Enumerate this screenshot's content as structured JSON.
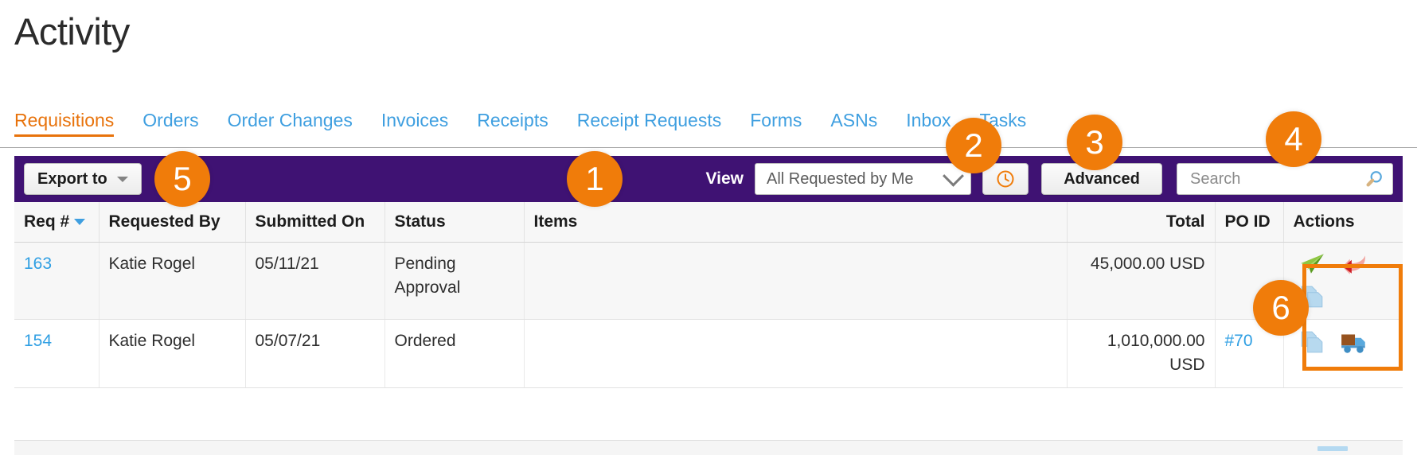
{
  "page": {
    "title": "Activity"
  },
  "tabs": [
    {
      "label": "Requisitions",
      "active": true
    },
    {
      "label": "Orders",
      "active": false
    },
    {
      "label": "Order Changes",
      "active": false
    },
    {
      "label": "Invoices",
      "active": false
    },
    {
      "label": "Receipts",
      "active": false
    },
    {
      "label": "Receipt Requests",
      "active": false
    },
    {
      "label": "Forms",
      "active": false
    },
    {
      "label": "ASNs",
      "active": false
    },
    {
      "label": "Inbox",
      "active": false
    },
    {
      "label": "Tasks",
      "active": false
    }
  ],
  "toolbar": {
    "export_label": "Export to",
    "view_label": "View",
    "view_value": "All Requested by Me",
    "history_icon": "clock-icon",
    "advanced_label": "Advanced",
    "search_placeholder": "Search",
    "search_value": "",
    "search_icon": "magnifier-icon",
    "bar_color": "#3f1273"
  },
  "table": {
    "columns": [
      {
        "key": "req",
        "label": "Req #",
        "sorted": true
      },
      {
        "key": "requested_by",
        "label": "Requested By"
      },
      {
        "key": "submitted_on",
        "label": "Submitted On"
      },
      {
        "key": "status",
        "label": "Status"
      },
      {
        "key": "items",
        "label": "Items"
      },
      {
        "key": "total",
        "label": "Total"
      },
      {
        "key": "po_id",
        "label": "PO ID"
      },
      {
        "key": "actions",
        "label": "Actions"
      }
    ],
    "rows": [
      {
        "req": "163",
        "requested_by": "Katie Rogel",
        "submitted_on": "05/11/21",
        "status": "Pending Approval",
        "items": "",
        "total": "45,000.00 USD",
        "po_id": "",
        "actions": [
          "send-icon",
          "withdraw-icon",
          "copy-icon"
        ]
      },
      {
        "req": "154",
        "requested_by": "Katie Rogel",
        "submitted_on": "05/07/21",
        "status": "Ordered",
        "items": "",
        "total": "1,010,000.00 USD",
        "po_id": "#70",
        "actions": [
          "copy-icon",
          "receive-truck-icon"
        ]
      }
    ]
  },
  "callouts": [
    {
      "id": "1",
      "label": "1"
    },
    {
      "id": "2",
      "label": "2"
    },
    {
      "id": "3",
      "label": "3"
    },
    {
      "id": "4",
      "label": "4"
    },
    {
      "id": "5",
      "label": "5"
    },
    {
      "id": "6",
      "label": "6"
    }
  ],
  "colors": {
    "accent_orange": "#f07c0a",
    "toolbar_purple": "#3f1273",
    "link_blue": "#2f9fe3",
    "tab_blue": "#3f9fe0"
  }
}
